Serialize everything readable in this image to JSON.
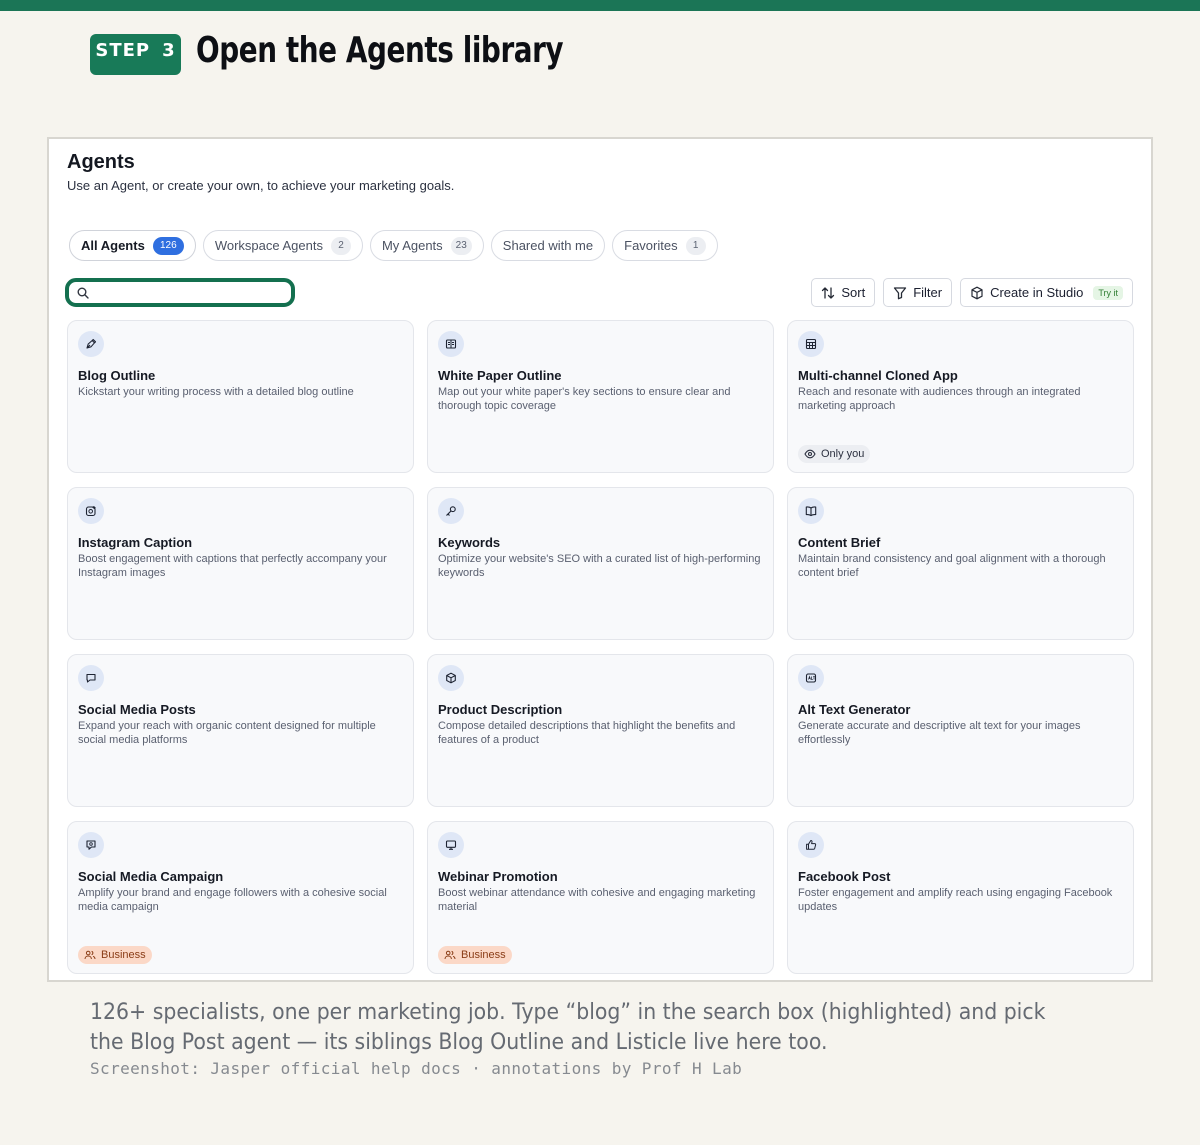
{
  "step": {
    "label": "STEP",
    "number": "3",
    "title": "Open the Agents library"
  },
  "page": {
    "title": "Agents",
    "subtitle": "Use an Agent, or create your own, to achieve your marketing goals."
  },
  "tabs": [
    {
      "label": "All Agents",
      "count": "126"
    },
    {
      "label": "Workspace Agents",
      "count": "2"
    },
    {
      "label": "My Agents",
      "count": "23"
    },
    {
      "label": "Shared with me",
      "count": ""
    },
    {
      "label": "Favorites",
      "count": "1"
    }
  ],
  "search": {
    "value": "",
    "placeholder": ""
  },
  "toolbar": {
    "sort": "Sort",
    "filter": "Filter",
    "create": "Create in Studio",
    "try_badge": "Try it"
  },
  "cards": [
    {
      "icon": "pen-nib-icon",
      "title": "Blog Outline",
      "desc": "Kickstart your writing process with a detailed blog outline",
      "badge": ""
    },
    {
      "icon": "newspaper-icon",
      "title": "White Paper Outline",
      "desc": "Map out your white paper's key sections to ensure clear and thorough topic coverage",
      "badge": ""
    },
    {
      "icon": "grid-table-icon",
      "title": "Multi-channel Cloned App",
      "desc": "Reach and resonate with audiences through an integrated marketing approach",
      "badge": "Only you"
    },
    {
      "icon": "instagram-image-icon",
      "title": "Instagram Caption",
      "desc": "Boost engagement with captions that perfectly accompany your Instagram images",
      "badge": ""
    },
    {
      "icon": "key-icon",
      "title": "Keywords",
      "desc": "Optimize your website's SEO with a curated list of high-performing keywords",
      "badge": ""
    },
    {
      "icon": "book-open-icon",
      "title": "Content Brief",
      "desc": "Maintain brand consistency and goal alignment with a thorough content brief",
      "badge": ""
    },
    {
      "icon": "chat-bubble-icon",
      "title": "Social Media Posts",
      "desc": "Expand your reach with organic content designed for multiple social media platforms",
      "badge": ""
    },
    {
      "icon": "box-icon",
      "title": "Product Description",
      "desc": "Compose detailed descriptions that highlight the benefits and features of a product",
      "badge": ""
    },
    {
      "icon": "alt-text-icon",
      "title": "Alt Text Generator",
      "desc": "Generate accurate and descriptive alt text for your images effortlessly",
      "badge": ""
    },
    {
      "icon": "campaign-bubble-icon",
      "title": "Social Media Campaign",
      "desc": "Amplify your brand and engage followers with a cohesive social media campaign",
      "badge": "Business"
    },
    {
      "icon": "monitor-icon",
      "title": "Webinar Promotion",
      "desc": "Boost webinar attendance with cohesive and engaging marketing material",
      "badge": "Business"
    },
    {
      "icon": "thumbs-up-icon",
      "title": "Facebook Post",
      "desc": "Foster engagement and amplify reach using engaging Facebook updates",
      "badge": ""
    }
  ],
  "caption": "126+ specialists, one per marketing job. Type “blog” in the search box (highlighted) and pick the Blog Post agent — its siblings Blog Outline and Listicle live here too.",
  "credit": "Screenshot: Jasper official help docs · annotations by Prof H Lab",
  "colors": {
    "accent_green": "#1b7556",
    "tab_count_blue": "#2f6fe0",
    "business_badge": "#fbd8c7"
  }
}
